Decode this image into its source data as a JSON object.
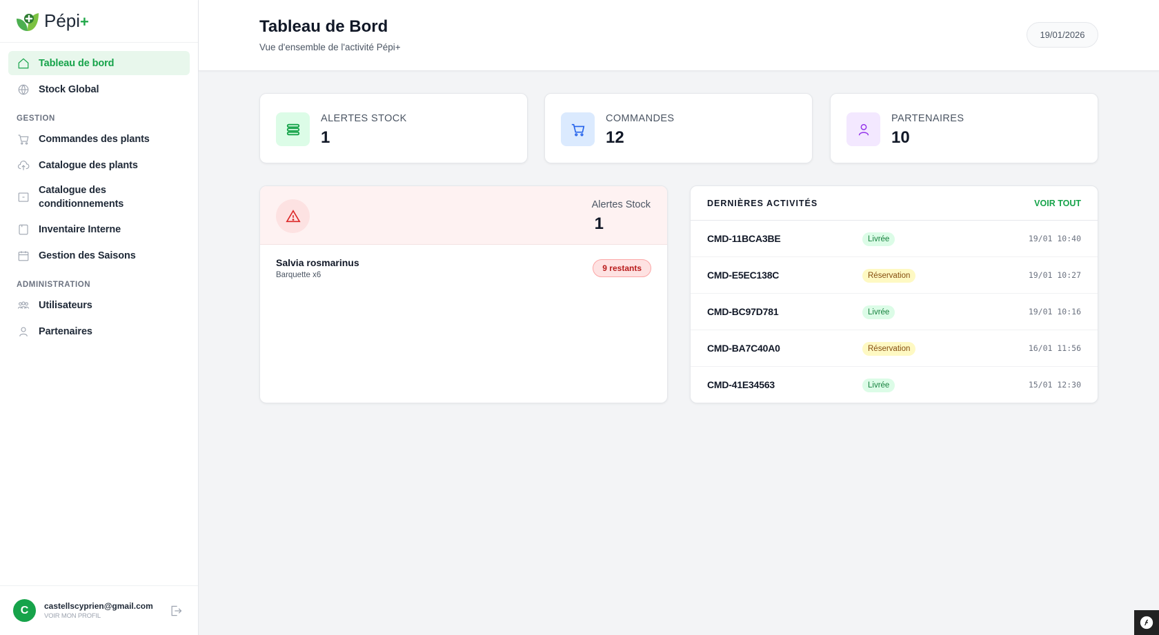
{
  "app": {
    "name": "Pépi",
    "name_plus": "+"
  },
  "sidebar": {
    "top_items": [
      {
        "label": "Tableau de bord",
        "icon": "home-icon",
        "active": true
      },
      {
        "label": "Stock Global",
        "icon": "globe-icon"
      }
    ],
    "section_gestion": "GESTION",
    "gestion_items": [
      {
        "label": "Commandes des plants",
        "icon": "cart-icon"
      },
      {
        "label": "Catalogue des plants",
        "icon": "cloud-upload-icon"
      },
      {
        "label": "Catalogue des conditionnements",
        "icon": "box-icon"
      },
      {
        "label": "Inventaire Interne",
        "icon": "clipboard-icon"
      },
      {
        "label": "Gestion des Saisons",
        "icon": "calendar-icon"
      }
    ],
    "section_admin": "ADMINISTRATION",
    "admin_items": [
      {
        "label": "Utilisateurs",
        "icon": "users-icon"
      },
      {
        "label": "Partenaires",
        "icon": "user-icon"
      }
    ],
    "user": {
      "initial": "C",
      "email": "castellscyprien@gmail.com",
      "profile_link": "VOIR MON PROFIL"
    }
  },
  "header": {
    "title": "Tableau de Bord",
    "subtitle": "Vue d'ensemble de l'activité Pépi+",
    "date": "19/01/2026"
  },
  "stats": [
    {
      "label": "ALERTES STOCK",
      "value": "1",
      "icon": "server-icon",
      "color": "#16a34a",
      "bg": "#dcfce7"
    },
    {
      "label": "COMMANDES",
      "value": "12",
      "icon": "cart-icon",
      "color": "#2563eb",
      "bg": "#dbeafe"
    },
    {
      "label": "PARTENAIRES",
      "value": "10",
      "icon": "user-icon",
      "color": "#9333ea",
      "bg": "#f3e8ff"
    }
  ],
  "alerts": {
    "title": "Alertes Stock",
    "count": "1",
    "items": [
      {
        "name": "Salvia rosmarinus",
        "pack": "Barquette x6",
        "remaining": "9 restants"
      }
    ]
  },
  "activities": {
    "title": "DERNIÈRES ACTIVITÉS",
    "link": "VOIR TOUT",
    "rows": [
      {
        "id": "CMD-11BCA3BE",
        "status": "Livrée",
        "kind": "green",
        "time": "19/01 10:40"
      },
      {
        "id": "CMD-E5EC138C",
        "status": "Réservation",
        "kind": "yellow",
        "time": "19/01 10:27"
      },
      {
        "id": "CMD-BC97D781",
        "status": "Livrée",
        "kind": "green",
        "time": "19/01 10:16"
      },
      {
        "id": "CMD-BA7C40A0",
        "status": "Réservation",
        "kind": "yellow",
        "time": "16/01 11:56"
      },
      {
        "id": "CMD-41E34563",
        "status": "Livrée",
        "kind": "green",
        "time": "15/01 12:30"
      }
    ]
  }
}
